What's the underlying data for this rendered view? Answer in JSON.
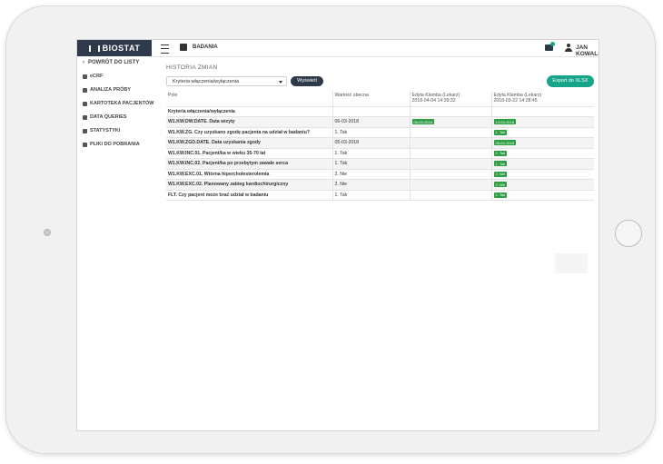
{
  "app": {
    "logo_text": "BIOSTAT"
  },
  "topbar": {
    "section_label": "BADANIA",
    "mail_count": "",
    "user_name": "JAN KOWALSKI"
  },
  "sidebar": {
    "back_label": "POWRÓT DO LISTY",
    "items": [
      {
        "label": "eCRF"
      },
      {
        "label": "ANALIZA PRÓBY"
      },
      {
        "label": "KARTOTEKA PACJENTÓW"
      },
      {
        "label": "DATA QUERIES"
      },
      {
        "label": "STATYSTYKI"
      },
      {
        "label": "PLIKI DO POBRANIA"
      }
    ]
  },
  "main": {
    "title": "HISTORIA ZMIAN",
    "filter": {
      "selected": "Kryteria włączenia/wyłączenia",
      "show_label": "Wyświetl"
    },
    "export_label": "Export do XLSX",
    "table": {
      "headers": [
        {
          "line1": "Pole",
          "line2": ""
        },
        {
          "line1": "Wartość obecna",
          "line2": ""
        },
        {
          "line1": "Edyta Klemba (Lekarz)",
          "line2": "2018-04-04 14:39:32"
        },
        {
          "line1": "Edyta Klemba (Lekarz)",
          "line2": "2018-03-22 14:28:45"
        }
      ],
      "group_label": "Kryteria włączenia/wyłączenia",
      "rows": [
        {
          "field": "W1.KW.DW.DATE. Data wizyty",
          "value": "06-03-2018",
          "c1": "06-03-2018",
          "c2": "13-03-2018"
        },
        {
          "field": "W1.KW.ZG. Czy uzyskano zgodę pacjenta na udział w badaniu?",
          "value": "1. Tak",
          "c1": "",
          "c2": "1. Tak"
        },
        {
          "field": "W1.KW.ZGD.DATE. Data uzyskania zgody",
          "value": "05-03-2018",
          "c1": "",
          "c2": "05-03-2018"
        },
        {
          "field": "W1.KW.INC.01. Pacjent/ka w wieku 35-70 lat",
          "value": "1. Tak",
          "c1": "",
          "c2": "1. Tak"
        },
        {
          "field": "W1.KW.INC.02. Pacjent/ka po przebytym zawale serca",
          "value": "1. Tak",
          "c1": "",
          "c2": "1. Tak"
        },
        {
          "field": "W1.KW.EXC.01. Wtórna hipercholesterolemia",
          "value": "2. Nie",
          "c1": "",
          "c2": "2. Nie"
        },
        {
          "field": "W1.KW.EXC.02. Planowany zabieg kardiochirurgiczny",
          "value": "2. Nie",
          "c1": "",
          "c2": "2. Nie"
        },
        {
          "field": "FLT. Czy pacjent może brać udział w badaniu",
          "value": "1. Tak",
          "c1": "",
          "c2": "1. Tak"
        }
      ]
    }
  },
  "colors": {
    "primary_dark": "#2e3a4c",
    "accent_teal": "#17a589",
    "badge_green": "#2e9e44"
  }
}
